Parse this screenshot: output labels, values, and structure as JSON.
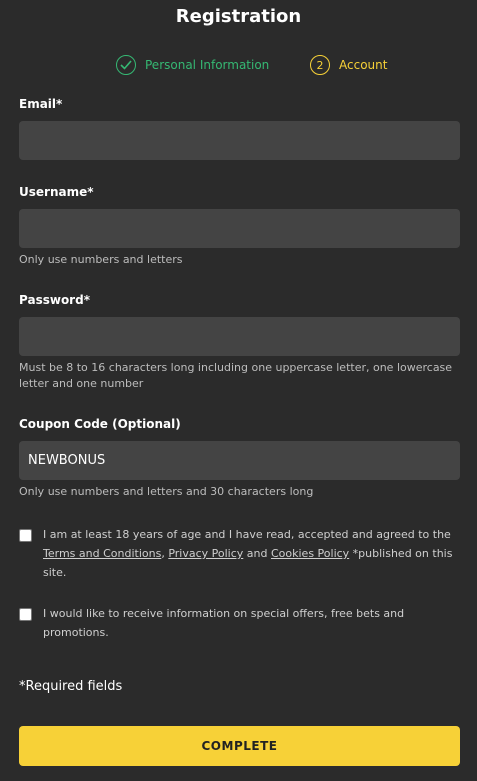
{
  "page": {
    "title": "Registration"
  },
  "steps": [
    {
      "label": "Personal Information",
      "status": "completed",
      "icon": "checkmark-icon",
      "color": "#35b873"
    },
    {
      "label": "Account",
      "number": "2",
      "status": "active",
      "color": "#f7d137"
    }
  ],
  "fields": {
    "email": {
      "label": "Email*",
      "value": ""
    },
    "username": {
      "label": "Username*",
      "value": "",
      "hint": "Only use numbers and letters"
    },
    "password": {
      "label": "Password*",
      "value": "",
      "hint": "Must be 8 to 16 characters long including one uppercase letter, one lowercase letter and one number"
    },
    "coupon": {
      "label": "Coupon Code (Optional)",
      "value": "NEWBONUS",
      "hint": "Only use numbers and letters and 30 characters long"
    }
  },
  "consents": {
    "age": {
      "checked": false,
      "text_before": "I am at least 18 years of age and I have read, accepted and agreed to the ",
      "terms_link": "Terms and Conditions",
      "sep1": ", ",
      "privacy_link": "Privacy Policy",
      "sep2": " and ",
      "cookies_link": "Cookies Policy",
      "text_after": " *published on this site."
    },
    "offers": {
      "checked": false,
      "text": "I would like to receive information on special offers, free bets and promotions."
    }
  },
  "footer": {
    "required_note": "*Required fields",
    "complete_label": "COMPLETE"
  },
  "colors": {
    "background": "#2b2b2b",
    "input_bg": "#444444",
    "accent_yellow": "#f7d137",
    "success_green": "#35b873"
  }
}
